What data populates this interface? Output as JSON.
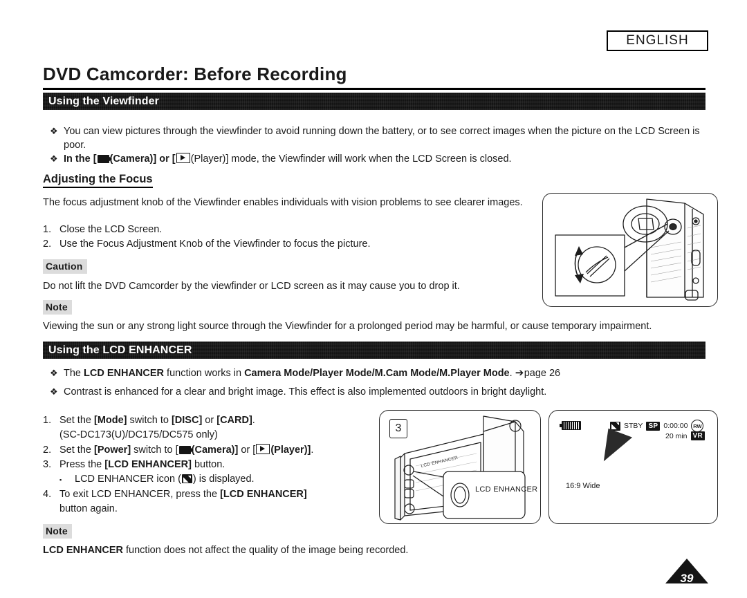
{
  "language_badge": "ENGLISH",
  "page_title": "DVD Camcorder: Before Recording",
  "page_number": "39",
  "icons": {
    "bullet_diamond": "❖",
    "sub_bullet_square": "▪",
    "arrow_right": "➔",
    "camera_icon": "camera-icon",
    "player_icon": "player-icon",
    "lcd_enhancer_icon": "lcd-enhancer-icon"
  },
  "sections": {
    "viewfinder": {
      "header": "Using the Viewfinder",
      "bullets": [
        {
          "text_a": "You can view pictures through the viewfinder to avoid running down the battery, or to see correct images when the picture on the LCD Screen is poor."
        },
        {
          "pre": "In the [",
          "mid_a": "(Camera)] or [",
          "mid_b": "(Player)] mode, the Viewfinder will work when the LCD Screen is closed."
        }
      ],
      "sub_heading": "Adjusting the Focus",
      "intro": "The focus adjustment knob of the Viewfinder enables individuals with vision problems to see clearer images.",
      "steps": [
        {
          "num": "1.",
          "text": "Close the LCD Screen."
        },
        {
          "num": "2.",
          "text": "Use the Focus Adjustment Knob of the Viewfinder to focus the picture."
        }
      ],
      "caution_label": "Caution",
      "caution_text": "Do not lift the DVD Camcorder by the viewfinder or LCD screen as it may cause you to drop it.",
      "note_label": "Note",
      "note_text": "Viewing the sun or any strong light source through the Viewfinder for a prolonged period may be harmful, or cause temporary impairment."
    },
    "lcd_enhancer": {
      "header": "Using the LCD ENHANCER",
      "bullets": [
        {
          "pre": "The ",
          "bold_a": "LCD ENHANCER",
          "mid": " function works in ",
          "bold_b": "Camera Mode/Player Mode/M.Cam Mode/M.Player Mode",
          "post": ". ",
          "page_ref": "page 26"
        },
        {
          "text": "Contrast is enhanced for a clear and bright image. This effect is also implemented outdoors in bright daylight."
        }
      ],
      "steps": [
        {
          "num": "1.",
          "pre": "Set the ",
          "bold_a": "[Mode]",
          "mid": " switch to ",
          "bold_b": "[DISC]",
          "mid2": " or ",
          "bold_c": "[CARD]",
          "post": ".",
          "line2": "(SC-DC173(U)/DC175/DC575 only)"
        },
        {
          "num": "2.",
          "pre": "Set the ",
          "bold_a": "[Power]",
          "mid": " switch to [",
          "bold_b": "(Camera)]",
          "mid2": " or [",
          "bold_c": "(Player)]",
          "post": "."
        },
        {
          "num": "3.",
          "pre": "Press the ",
          "bold_a": "[LCD ENHANCER]",
          "post": " button.",
          "sub_pre": "LCD ENHANCER icon (",
          "sub_post": ") is displayed."
        },
        {
          "num": "4.",
          "pre": "To exit LCD ENHANCER, press the ",
          "bold_a": "[LCD ENHANCER]",
          "line2": "button again."
        }
      ],
      "note_label": "Note",
      "note_bold": "LCD ENHANCER",
      "note_text": " function does not affect the quality of the image being recorded."
    }
  },
  "figures": {
    "viewfinder_focus": {
      "name": "camcorder-viewfinder-focus-knob-illustration"
    },
    "enhancer_button": {
      "step_chip": "3",
      "callout_label": "LCD ENHANCER",
      "body_label": "LCD ENHANCER"
    },
    "lcd_display": {
      "status_mode": "STBY",
      "quality": "SP",
      "timecode": "0:00:00",
      "disc_format": "RW",
      "remaining": "20 min",
      "record_mode": "VR",
      "aspect": "16:9 Wide"
    }
  }
}
